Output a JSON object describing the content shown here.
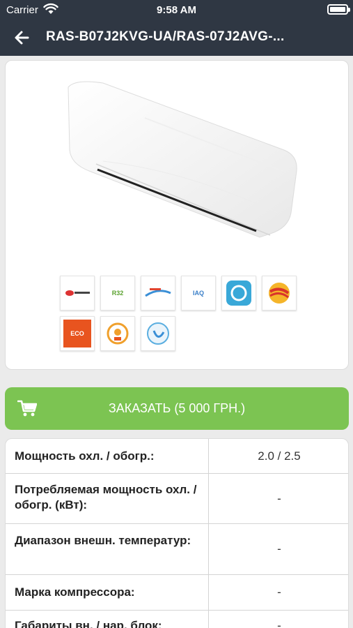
{
  "status_bar": {
    "carrier": "Carrier",
    "time": "9:58 AM"
  },
  "nav": {
    "title": "RAS-B07J2KVG-UA/RAS-07J2AVG-..."
  },
  "order": {
    "label": "ЗАКАЗАТЬ (5 000 ГРН.)"
  },
  "badges": [
    "",
    "R32",
    "",
    "IAQ",
    "",
    "",
    "ECO",
    "",
    ""
  ],
  "specs": [
    {
      "name": "Мощность охл. / обогр.:",
      "value": "2.0 / 2.5"
    },
    {
      "name": "Потребляемая мощность охл. / обогр. (кВт):",
      "value": "-"
    },
    {
      "name": "Диапазон внешн. температур:",
      "value": "-"
    },
    {
      "name": "Марка компрессора:",
      "value": "-"
    },
    {
      "name": "Габариты вн. / нар. блок:",
      "value": "-"
    }
  ],
  "colors": {
    "header": "#2f3743",
    "accent": "#7cc452",
    "background": "#ebebeb"
  }
}
